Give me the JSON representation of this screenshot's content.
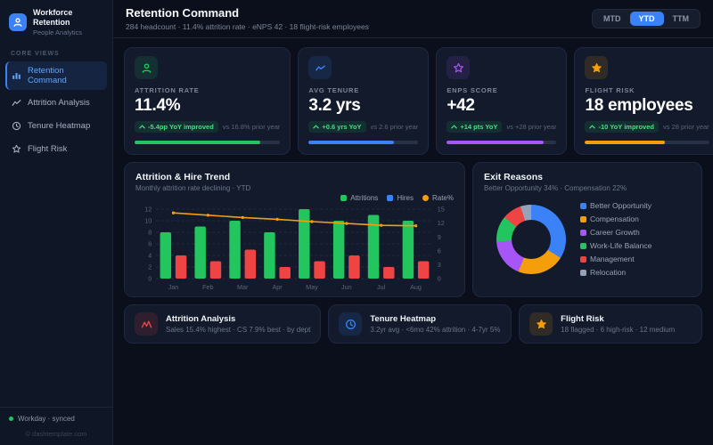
{
  "app": {
    "title": "Workforce Retention",
    "subtitle": "People Analytics"
  },
  "sidebar": {
    "section_label": "CORE VIEWS",
    "items": [
      {
        "label": "Retention Command"
      },
      {
        "label": "Attrition Analysis"
      },
      {
        "label": "Tenure Heatmap"
      },
      {
        "label": "Flight Risk"
      }
    ],
    "footer": {
      "sync": "Workday · synced",
      "copyright": "© dashtemplate.com"
    }
  },
  "header": {
    "title": "Retention Command",
    "subtitle": "284 headcount · 11.4% attrition rate · eNPS 42 · 18 flight-risk employees",
    "range_tabs": [
      {
        "label": "MTD"
      },
      {
        "label": "YTD"
      },
      {
        "label": "TTM"
      }
    ]
  },
  "kpis": [
    {
      "label": "ATTRITION RATE",
      "value": "11.4%",
      "badge": "-5.4pp YoY improved",
      "compare": "vs 16.8% prior year",
      "color": "#22c55e",
      "progress": 86
    },
    {
      "label": "AVG TENURE",
      "value": "3.2 yrs",
      "badge": "+0.6 yrs YoY",
      "compare": "vs 2.6 prior year",
      "color": "#3b82f6",
      "progress": 78
    },
    {
      "label": "ENPS SCORE",
      "value": "+42",
      "badge": "+14 pts YoY",
      "compare": "vs +28 prior year",
      "color": "#a855f7",
      "progress": 88
    },
    {
      "label": "FLIGHT RISK",
      "value": "18 employees",
      "badge": "-10 YoY improved",
      "compare": "vs 28 prior year",
      "color": "#f59e0b",
      "progress": 64
    }
  ],
  "chart_data": [
    {
      "type": "bar",
      "title": "Attrition & Hire Trend",
      "subtitle": "Monthly attrition rate declining · YTD",
      "categories": [
        "Jan",
        "Feb",
        "Mar",
        "Apr",
        "May",
        "Jun",
        "Jul",
        "Aug"
      ],
      "series": [
        {
          "name": "Attritions",
          "type": "bar",
          "color": "#22c55e",
          "legend_color": "#22c55e",
          "axis": "left",
          "values": [
            8,
            9,
            10,
            8,
            12,
            10,
            11,
            10
          ]
        },
        {
          "name": "Hires",
          "type": "bar",
          "color": "#ef4444",
          "legend_color": "#3b82f6",
          "axis": "left",
          "values": [
            4,
            3,
            5,
            2,
            3,
            4,
            2,
            3
          ]
        },
        {
          "name": "Rate%",
          "type": "line",
          "color": "#f59e0b",
          "legend_color": "#f59e0b",
          "axis": "right",
          "values": [
            14.2,
            13.7,
            13.2,
            12.8,
            12.3,
            11.9,
            11.5,
            11.4
          ]
        }
      ],
      "left_axis": {
        "min": 0,
        "max": 12,
        "ticks": [
          0,
          2,
          4,
          6,
          8,
          10,
          12
        ]
      },
      "right_axis": {
        "min": 0,
        "max": 15,
        "ticks": [
          0,
          3,
          6,
          9,
          12,
          15
        ]
      },
      "grid": "dashed horizontal",
      "legend_position": "top-right"
    },
    {
      "type": "pie",
      "title": "Exit Reasons",
      "subtitle": "Better Opportunity 34% · Compensation 22%",
      "donut": true,
      "segments": [
        {
          "label": "Better Opportunity",
          "value": 34,
          "color": "#3b82f6"
        },
        {
          "label": "Compensation",
          "value": 22,
          "color": "#f59e0b"
        },
        {
          "label": "Career Growth",
          "value": 18,
          "color": "#a855f7"
        },
        {
          "label": "Work-Life Balance",
          "value": 12,
          "color": "#22c55e"
        },
        {
          "label": "Management",
          "value": 9,
          "color": "#ef4444"
        },
        {
          "label": "Relocation",
          "value": 5,
          "color": "#94a3b8"
        }
      ],
      "legend_position": "right"
    }
  ],
  "shortcuts": [
    {
      "title": "Attrition Analysis",
      "subtitle": "Sales 15.4% highest · CS 7.9% best · by dept",
      "color": "#ef4444"
    },
    {
      "title": "Tenure Heatmap",
      "subtitle": "3.2yr avg · <6mo 42% attrition · 4-7yr 5%",
      "color": "#3b82f6"
    },
    {
      "title": "Flight Risk",
      "subtitle": "18 flagged · 6 high-risk · 12 medium",
      "color": "#f59e0b"
    }
  ]
}
